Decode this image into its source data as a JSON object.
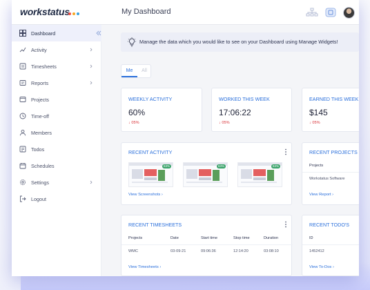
{
  "app": {
    "logo_text": "workstatus",
    "logo_dot_colors": [
      "#f04e45",
      "#f5a623",
      "#3aa3e0"
    ],
    "page_title": "My Dashboard",
    "accent_color": "#2a6fdb",
    "negative_color": "#d9343a"
  },
  "sidebar": {
    "items": [
      {
        "label": "Dashboard",
        "icon": "dashboard-icon",
        "active": true,
        "has_chevron": false
      },
      {
        "label": "Activity",
        "icon": "activity-icon",
        "active": false,
        "has_chevron": true
      },
      {
        "label": "Timesheets",
        "icon": "timesheets-icon",
        "active": false,
        "has_chevron": true
      },
      {
        "label": "Reports",
        "icon": "reports-icon",
        "active": false,
        "has_chevron": true
      },
      {
        "label": "Projects",
        "icon": "projects-icon",
        "active": false,
        "has_chevron": false
      },
      {
        "label": "Time-off",
        "icon": "time-off-icon",
        "active": false,
        "has_chevron": false
      },
      {
        "label": "Members",
        "icon": "members-icon",
        "active": false,
        "has_chevron": false
      },
      {
        "label": "Todos",
        "icon": "todos-icon",
        "active": false,
        "has_chevron": false
      },
      {
        "label": "Schedules",
        "icon": "schedules-icon",
        "active": false,
        "has_chevron": false
      },
      {
        "label": "Settings",
        "icon": "settings-icon",
        "active": false,
        "has_chevron": true
      },
      {
        "label": "Logout",
        "icon": "logout-icon",
        "active": false,
        "has_chevron": false
      }
    ]
  },
  "banner": {
    "text": "Manage the data which you would like to see on your Dashboard using Manage Widgets!"
  },
  "toggle": {
    "me_label": "Me",
    "all_label": "All"
  },
  "stats": {
    "weekly_activity": {
      "title": "WEEKLY ACTIVITY",
      "value": "60%",
      "change": "05%"
    },
    "worked_this_week": {
      "title": "WORKED THIS WEEK",
      "value": "17:06:22",
      "change": "05%"
    },
    "earned_this_week": {
      "title": "EARNED THIS WEEK",
      "value": "$145",
      "change": "05%"
    }
  },
  "recent_activity": {
    "title": "RECENT ACTIVITY",
    "badges": [
      "63%",
      "63%",
      "63%"
    ],
    "link": "View Screenshots"
  },
  "recent_projects": {
    "title": "RECENT PROJECTS",
    "header": "Projects",
    "rows": [
      "Workstatus Software"
    ],
    "link": "View Report"
  },
  "recent_timesheets": {
    "title": "RECENT TIMESHEETS",
    "columns": [
      "Projects",
      "Date",
      "Start time",
      "Stop time",
      "Duration"
    ],
    "rows": [
      [
        "WMC",
        "03-09-21",
        "09:06:36",
        "12:14:20",
        "03:08:10"
      ]
    ],
    "link": "View Timesheets"
  },
  "recent_todos": {
    "title": "RECENT TODO'S",
    "header": "ID",
    "rows": [
      "1452412"
    ],
    "link": "View To-Dos"
  }
}
